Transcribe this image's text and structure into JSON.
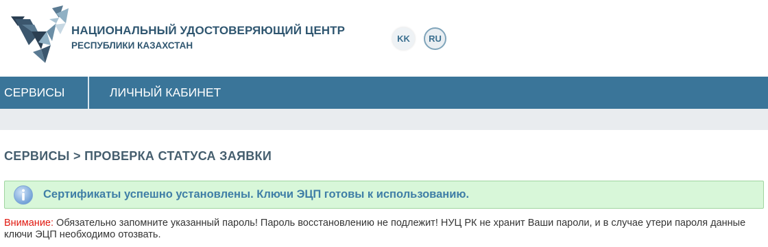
{
  "header": {
    "brand_line1": "НАЦИОНАЛЬНЫЙ УДОСТОВЕРЯЮЩИЙ ЦЕНТР",
    "brand_line2": "РЕСПУБЛИКИ КАЗАХСТАН",
    "languages": [
      "KK",
      "RU"
    ],
    "active_language": "RU",
    "logo_icon": "nuc-logo-icon"
  },
  "nav": {
    "items": [
      {
        "label": "СЕРВИСЫ"
      },
      {
        "label": "ЛИЧНЫЙ КАБИНЕТ"
      }
    ]
  },
  "breadcrumb": {
    "text": "СЕРВИСЫ > ПРОВЕРКА СТАТУСА ЗАЯВКИ"
  },
  "alert": {
    "icon": "info-icon",
    "text": "Сертификаты успешно установлены. Ключи ЭЦП готовы к использованию."
  },
  "warning": {
    "label": "Внимание:",
    "text": " Обязательно запомните указанный пароль! Пароль восстановлению не подлежит! НУЦ РК не хранит Ваши пароли, и в случае утери пароля данные ключи ЭЦП необходимо отозвать."
  },
  "colors": {
    "nav_bg": "#3a7599",
    "brand_text": "#2f5670",
    "alert_bg": "#d8f7d9",
    "alert_text": "#3f7ea6",
    "warning_label": "#e0180f"
  }
}
